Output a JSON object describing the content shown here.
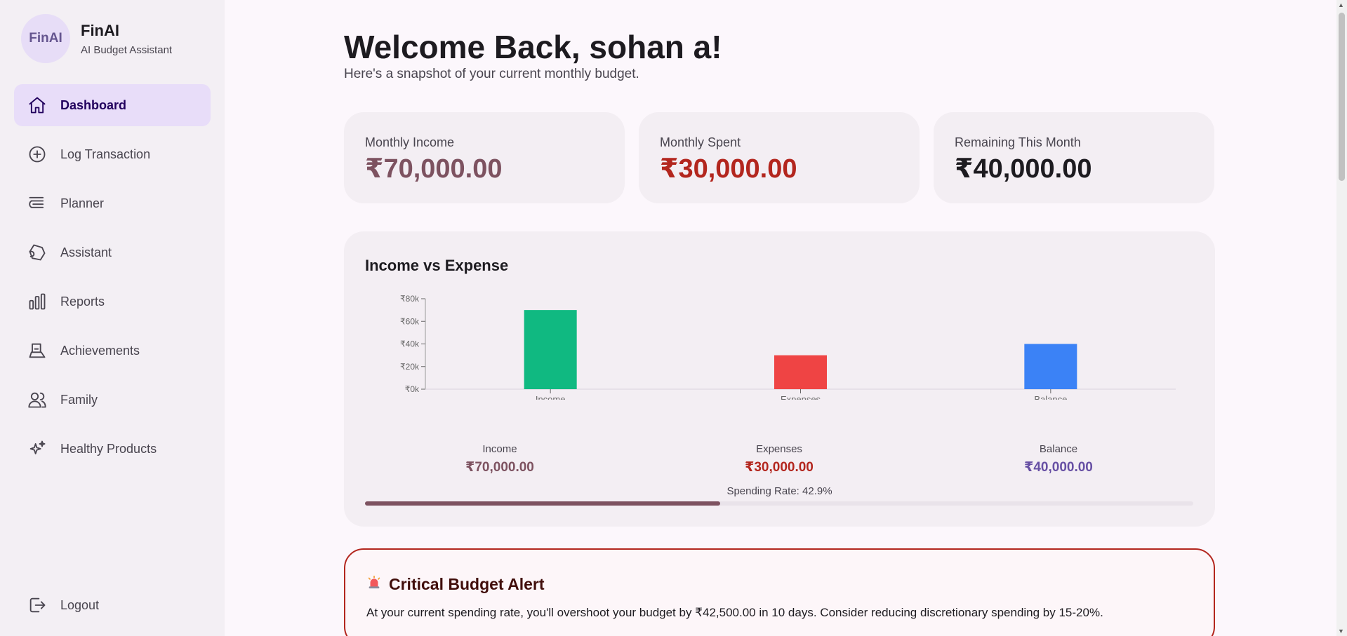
{
  "brand": {
    "logo": "FinAI",
    "name": "FinAI",
    "subtitle": "AI Budget Assistant"
  },
  "nav": {
    "items": [
      {
        "label": "Dashboard",
        "icon": "home-icon",
        "active": true
      },
      {
        "label": "Log Transaction",
        "icon": "plus-circle-icon"
      },
      {
        "label": "Planner",
        "icon": "planner-icon"
      },
      {
        "label": "Assistant",
        "icon": "assistant-icon"
      },
      {
        "label": "Reports",
        "icon": "bar-chart-icon"
      },
      {
        "label": "Achievements",
        "icon": "trophy-icon"
      },
      {
        "label": "Family",
        "icon": "family-icon"
      },
      {
        "label": "Healthy Products",
        "icon": "sparkle-icon"
      }
    ],
    "logout": {
      "label": "Logout",
      "icon": "logout-icon"
    }
  },
  "header": {
    "title": "Welcome Back, sohan a!",
    "subtitle": "Here's a snapshot of your current monthly budget."
  },
  "stats": {
    "income": {
      "label": "Monthly Income",
      "value": "₹70,000.00",
      "color": "#7d5260"
    },
    "spent": {
      "label": "Monthly Spent",
      "value": "₹30,000.00",
      "color": "#b3261e"
    },
    "remaining": {
      "label": "Remaining This Month",
      "value": "₹40,000.00",
      "color": "#1d1b20"
    }
  },
  "chart": {
    "title": "Income vs Expense",
    "summary": {
      "income": {
        "label": "Income",
        "value": "₹70,000.00"
      },
      "expenses": {
        "label": "Expenses",
        "value": "₹30,000.00"
      },
      "balance": {
        "label": "Balance",
        "value": "₹40,000.00"
      }
    },
    "spending_rate_text": "Spending Rate: 42.9%",
    "spending_rate": 0.429
  },
  "chart_data": {
    "type": "bar",
    "categories": [
      "Income",
      "Expenses",
      "Balance"
    ],
    "values": [
      70000,
      30000,
      40000
    ],
    "colors": [
      "#10b981",
      "#ef4444",
      "#3b82f6"
    ],
    "yticks": [
      "₹0k",
      "₹20k",
      "₹40k",
      "₹60k",
      "₹80k"
    ],
    "ylim": [
      0,
      80000
    ],
    "title": "",
    "xlabel": "",
    "ylabel": ""
  },
  "alert": {
    "icon": "siren-icon",
    "title": "Critical Budget Alert",
    "text": "At your current spending rate, you'll overshoot your budget by ₹42,500.00 in 10 days. Consider reducing discretionary spending by 15-20%."
  }
}
